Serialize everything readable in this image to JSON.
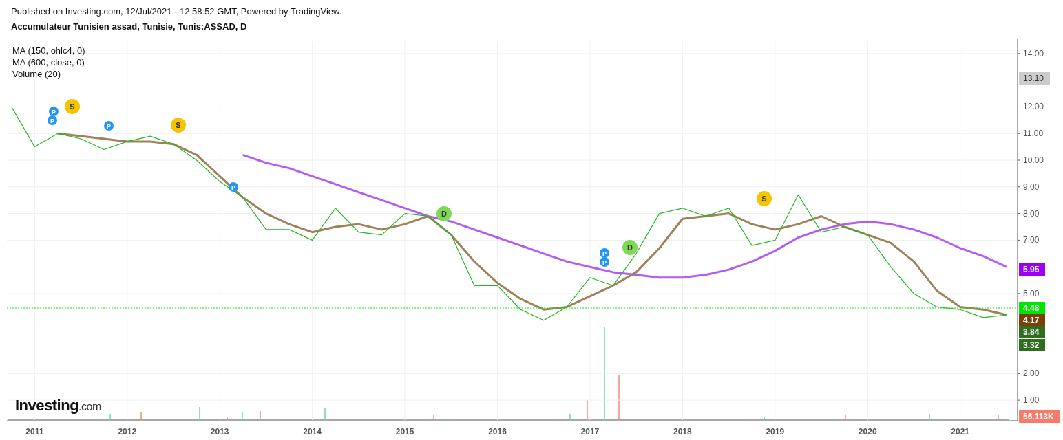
{
  "header": {
    "published": "Published on Investing.com, 12/Jul/2021 - 12:58:52 GMT, Powered by TradingView.",
    "title": "Accumulateur Tunisien assad, Tunisie, Tunis:ASSAD, D"
  },
  "chart": {
    "legend": [
      "MA (150, ohlc4, 0)",
      "MA (600, close, 0)",
      "Volume (20)"
    ],
    "logo": {
      "name": "Investing",
      "suffix": ".com"
    },
    "chart_data": {
      "type": "line",
      "grid": true,
      "x": [
        2010.75,
        2011,
        2011.25,
        2011.5,
        2011.75,
        2012,
        2012.25,
        2012.5,
        2012.75,
        2013,
        2013.25,
        2013.5,
        2013.75,
        2014,
        2014.25,
        2014.5,
        2014.75,
        2015,
        2015.25,
        2015.5,
        2015.75,
        2016,
        2016.25,
        2016.5,
        2016.75,
        2017,
        2017.25,
        2017.5,
        2017.75,
        2018,
        2018.25,
        2018.5,
        2018.75,
        2019,
        2019.25,
        2019.5,
        2019.75,
        2020,
        2020.25,
        2020.5,
        2020.75,
        2021,
        2021.25,
        2021.5
      ],
      "series": [
        {
          "color": "#22b822",
          "values": [
            12.0,
            10.5,
            11.0,
            10.8,
            10.4,
            10.7,
            10.9,
            10.6,
            10.0,
            9.2,
            8.6,
            7.4,
            7.4,
            7.0,
            8.2,
            7.3,
            7.2,
            8.0,
            7.9,
            7.2,
            5.3,
            5.3,
            4.4,
            4.0,
            4.5,
            5.6,
            5.3,
            6.5,
            8.0,
            8.2,
            7.9,
            8.2,
            6.8,
            7.0,
            8.7,
            7.3,
            7.5,
            7.2,
            6.0,
            5.0,
            4.5,
            4.4,
            4.1,
            4.2
          ]
        },
        {
          "color": "#a0805a",
          "values": [
            null,
            null,
            11.0,
            10.9,
            10.8,
            10.7,
            10.7,
            10.6,
            10.2,
            9.4,
            8.6,
            8.0,
            7.6,
            7.3,
            7.5,
            7.6,
            7.4,
            7.6,
            7.9,
            7.2,
            6.2,
            5.4,
            4.8,
            4.4,
            4.5,
            4.9,
            5.3,
            5.8,
            6.7,
            7.8,
            7.9,
            8.0,
            7.6,
            7.4,
            7.6,
            7.9,
            7.5,
            7.2,
            6.9,
            6.2,
            5.1,
            4.5,
            4.4,
            4.2
          ]
        },
        {
          "color": "#b35cf2",
          "values": [
            null,
            null,
            null,
            null,
            null,
            null,
            null,
            null,
            null,
            null,
            10.2,
            9.9,
            9.7,
            9.4,
            9.1,
            8.8,
            8.5,
            8.2,
            7.9,
            7.7,
            7.4,
            7.1,
            6.8,
            6.5,
            6.2,
            6.0,
            5.8,
            5.7,
            5.6,
            5.6,
            5.7,
            5.9,
            6.2,
            6.6,
            7.1,
            7.4,
            7.6,
            7.7,
            7.6,
            7.4,
            7.1,
            6.7,
            6.4,
            6.0
          ]
        }
      ],
      "xlim": [
        2010.7,
        2021.62
      ],
      "ylim": [
        0.23,
        14.46
      ],
      "xticks": [
        2011,
        2012,
        2013,
        2014,
        2015,
        2016,
        2017,
        2018,
        2019,
        2020,
        2021
      ],
      "yticks": [
        {
          "value": 1,
          "label": "1.00"
        },
        {
          "value": 2,
          "label": "2.00"
        },
        {
          "value": 5,
          "label": "5.00"
        },
        {
          "value": 7,
          "label": "7.00"
        },
        {
          "value": 8,
          "label": "8.00"
        },
        {
          "value": 9,
          "label": "9.00"
        },
        {
          "value": 10,
          "label": "10.00"
        },
        {
          "value": 11,
          "label": "11.00"
        },
        {
          "value": 12,
          "label": "12.00"
        },
        {
          "value": 14,
          "label": "14.00"
        }
      ]
    },
    "events": [
      {
        "kind": "small",
        "text": "P",
        "color": "#2196f3"
      },
      {
        "kind": "small",
        "text": "P",
        "color": "#2196f3"
      },
      {
        "kind": "large",
        "text": "S",
        "color": "#f5c400"
      },
      {
        "kind": "small",
        "text": "P",
        "color": "#2196f3"
      },
      {
        "kind": "large",
        "text": "S",
        "color": "#f5c400"
      },
      {
        "kind": "small",
        "text": "P",
        "color": "#2196f3"
      },
      {
        "kind": "large",
        "text": "D",
        "color": "#7ed957"
      },
      {
        "kind": "small",
        "text": "P",
        "color": "#2196f3"
      },
      {
        "kind": "small",
        "text": "P",
        "color": "#2196f3"
      },
      {
        "kind": "large",
        "text": "D",
        "color": "#7ed957"
      },
      {
        "kind": "large",
        "text": "S",
        "color": "#f5c400"
      }
    ],
    "price_labels": [
      {
        "text": "13.10",
        "color": "#cccccc"
      },
      {
        "text": "5.95",
        "color": "#9b00f5"
      },
      {
        "kind": "last",
        "text": "4.48",
        "color": "#00e600"
      },
      {
        "text": "4.17",
        "color": "#7a3f0a"
      },
      {
        "text": "3.84",
        "color": "#2e6e1e"
      },
      {
        "text": "3.32",
        "color": "#2e6e1e"
      },
      {
        "text": "56.113K",
        "color": "#f77a6a"
      }
    ]
  }
}
